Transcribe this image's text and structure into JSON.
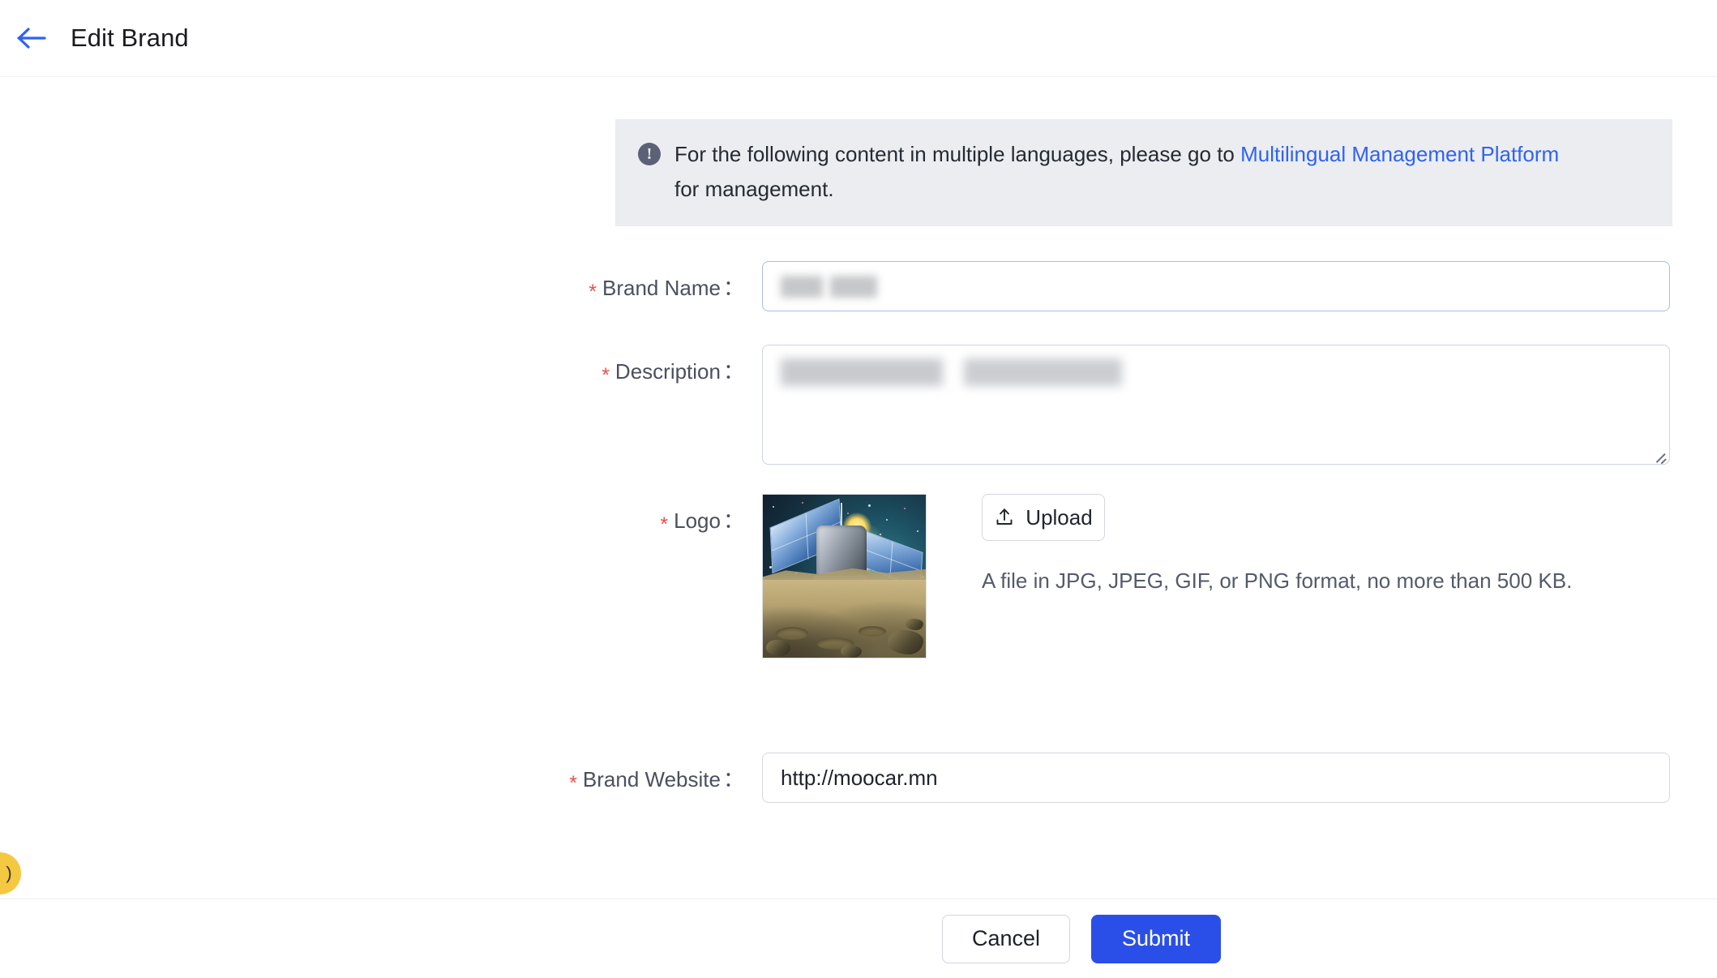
{
  "header": {
    "back_icon": "arrow-left-icon",
    "title": "Edit Brand",
    "accent_color": "#2f62f5"
  },
  "banner": {
    "icon": "info-circle-icon",
    "text_before_link": "For the following content in multiple languages, please go to ",
    "link_text": "Multilingual Management Platform",
    "text_after_link": " for management.",
    "background_color": "#ebedf1",
    "link_color": "#2f62f5"
  },
  "form": {
    "required_marker": "*",
    "colon": "：",
    "fields": {
      "brand_name": {
        "label": "Brand Name",
        "value": "",
        "placeholder": "",
        "redacted": true,
        "focused": true
      },
      "description": {
        "label": "Description",
        "value": "",
        "placeholder": "",
        "redacted": true
      },
      "logo": {
        "label": "Logo",
        "image_alt": "lunar-lander-on-moon-surface",
        "upload_button_label": "Upload",
        "upload_icon": "upload-icon",
        "hint": "A file in JPG, JPEG, GIF, or PNG format, no more than 500 KB."
      },
      "brand_website": {
        "label": "Brand Website",
        "value": "http://moocar.mn",
        "placeholder": ""
      }
    }
  },
  "footer": {
    "cancel_label": "Cancel",
    "submit_label": "Submit",
    "submit_color": "#2a4fe8"
  },
  "edge_widget": {
    "icon": "chat-bubble-icon",
    "glyph": ")",
    "color": "#f5c842"
  }
}
